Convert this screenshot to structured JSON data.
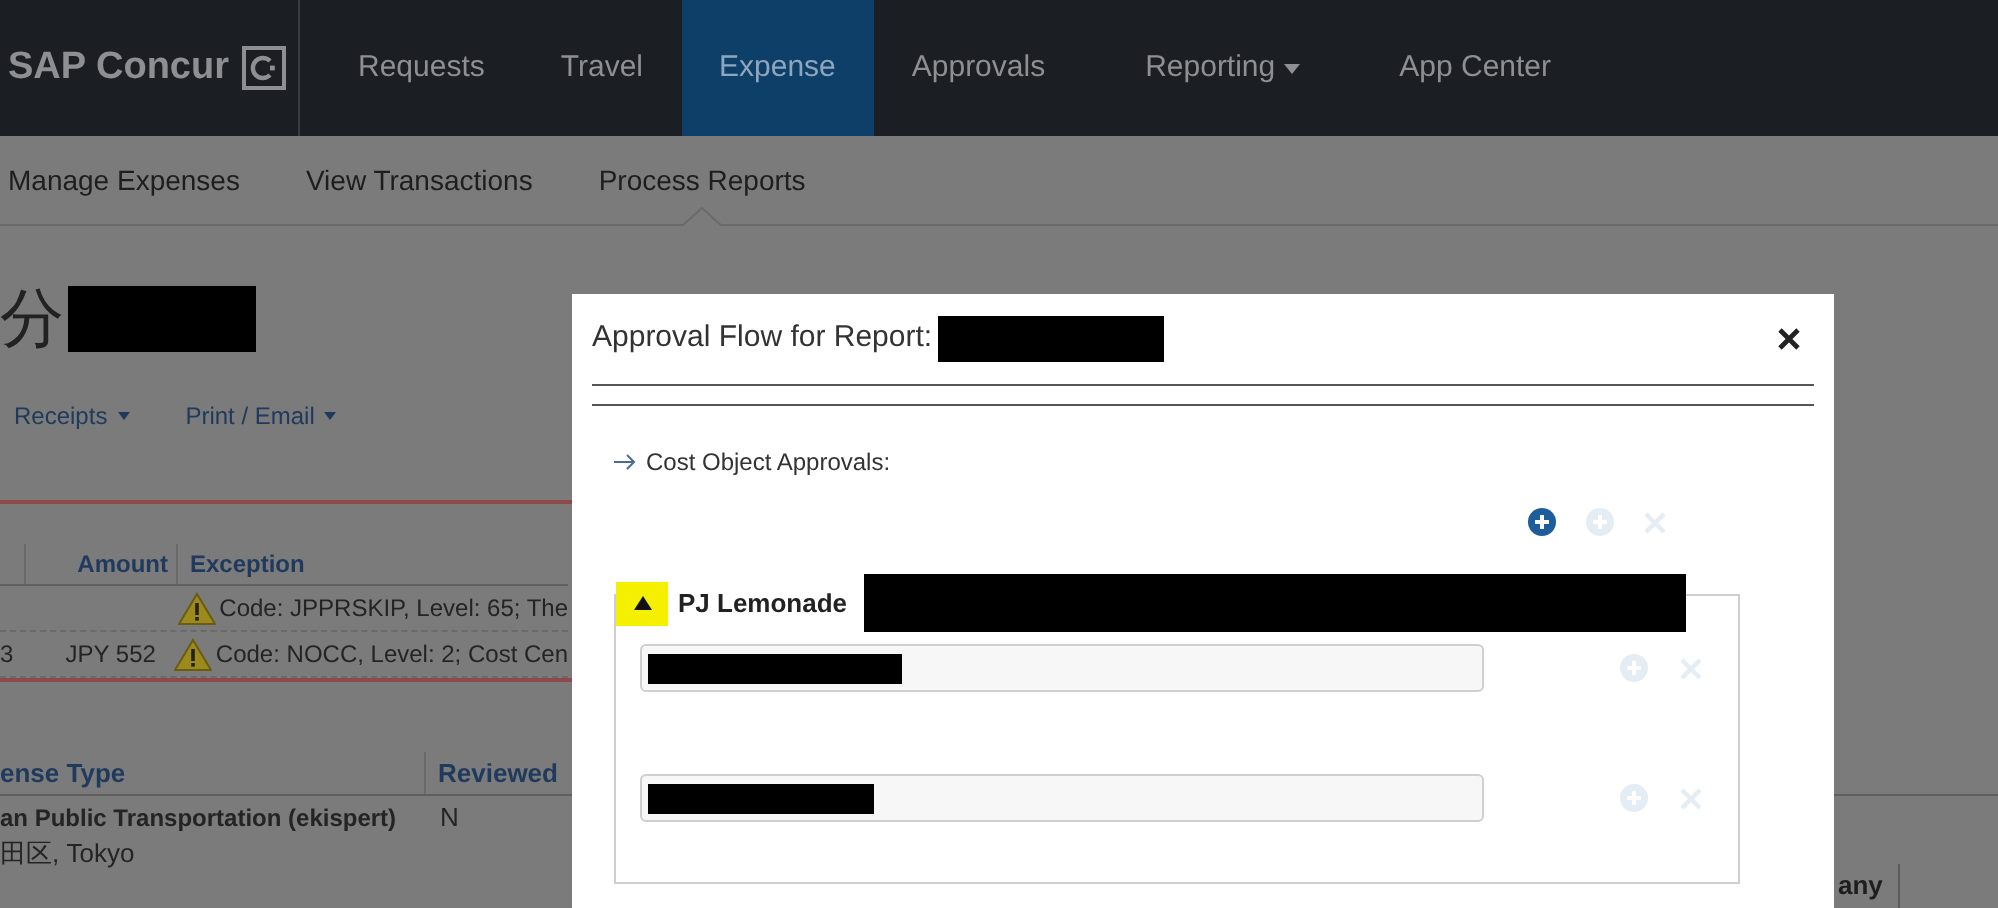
{
  "nav": {
    "logo": "SAP Concur",
    "tabs": [
      {
        "label": "Requests",
        "selected": false,
        "has_menu": false
      },
      {
        "label": "Travel",
        "selected": false,
        "has_menu": false
      },
      {
        "label": "Expense",
        "selected": true,
        "has_menu": false
      },
      {
        "label": "Approvals",
        "selected": false,
        "has_menu": false
      },
      {
        "label": "Reporting",
        "selected": false,
        "has_menu": true
      },
      {
        "label": "App Center",
        "selected": false,
        "has_menu": false
      }
    ]
  },
  "subnav": [
    {
      "label": "Manage Expenses",
      "selected": false
    },
    {
      "label": "View Transactions",
      "selected": false
    },
    {
      "label": "Process Reports",
      "selected": true
    }
  ],
  "report": {
    "title": "分",
    "actions": [
      {
        "label": "Receipts"
      },
      {
        "label": "Print / Email"
      }
    ]
  },
  "exceptions_table": {
    "columns": [
      {
        "label": "Amount"
      },
      {
        "label": "Exception"
      }
    ],
    "rows": [
      {
        "exception": "Code: JPPRSKIP, Level: 65; The"
      },
      {
        "column_1": "3",
        "amount": "JPY 552",
        "exception": "Code: NOCC, Level: 2; Cost Cen"
      }
    ]
  },
  "expenses_table": {
    "columns": [
      "ense Type",
      "Reviewed",
      "any"
    ],
    "rows": [
      {
        "type": "an Public Transportation (ekispert)",
        "location": "田区, Tokyo",
        "reviewed": "N"
      }
    ]
  },
  "modal": {
    "title": "Approval Flow for Report:",
    "section": "Cost Object Approvals:",
    "toolbar": [
      {
        "kind": "add",
        "disabled": false
      },
      {
        "kind": "add",
        "disabled": true
      },
      {
        "kind": "remove",
        "disabled": true
      }
    ],
    "group": {
      "name": "PJ Lemonade",
      "expanded": true,
      "approvers": [
        {
          "add_disabled": true,
          "remove_disabled": true
        },
        {
          "add_disabled": true,
          "remove_disabled": true
        }
      ]
    }
  }
}
